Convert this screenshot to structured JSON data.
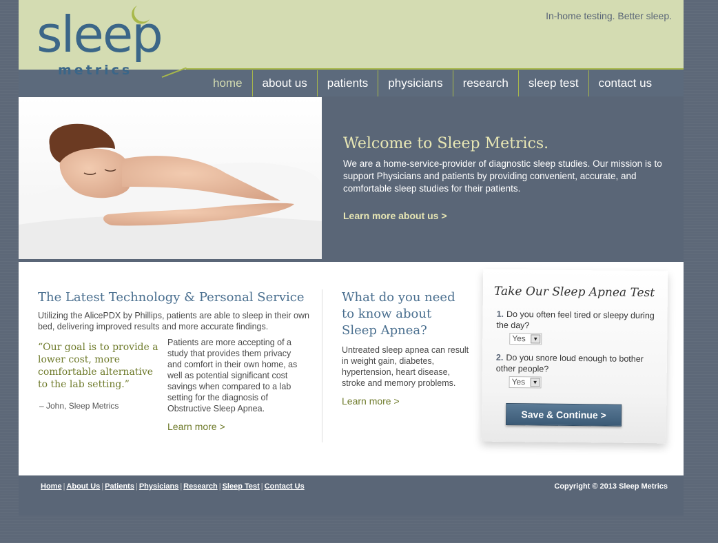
{
  "header": {
    "logo_word": "sleep",
    "logo_sub": "metrics",
    "tagline": "In-home testing. Better sleep."
  },
  "nav": {
    "items": [
      {
        "label": "home"
      },
      {
        "label": "about us"
      },
      {
        "label": "patients"
      },
      {
        "label": "physicians"
      },
      {
        "label": "research"
      },
      {
        "label": "sleep test"
      },
      {
        "label": "contact us"
      }
    ]
  },
  "hero": {
    "title": "Welcome to Sleep Metrics.",
    "body": "We are a home-service-provider of diagnostic sleep studies. Our mission is to support Physicians and patients by providing convenient, accurate, and comfortable sleep studies for their patients.",
    "link": "Learn more about us >"
  },
  "tech": {
    "title": "The Latest Technology & Personal Service",
    "intro": "Utilizing the AlicePDX by Phillips, patients are able to sleep in their own bed, delivering improved results and more accurate findings.",
    "quote": "“Our goal is to provide a lower cost, more comfortable alternative to the lab setting.”",
    "quote_attr": "– John, Sleep Metrics",
    "body": "Patients are more accepting of a study that provides them privacy and comfort in their own home, as well as potential significant cost savings when compared to a lab setting for the diagnosis of Obstructive Sleep Apnea.",
    "link": "Learn more >"
  },
  "apnea": {
    "title": "What do you need to know about Sleep Apnea?",
    "body": "Untreated sleep apnea can result in weight gain, diabetes, hypertension, heart disease, stroke and memory problems.",
    "link": "Learn more >"
  },
  "test": {
    "title": "Take Our Sleep Apnea Test",
    "questions": [
      {
        "num": "1.",
        "text": "Do you often feel tired or sleepy during the day?",
        "value": "Yes"
      },
      {
        "num": "2.",
        "text": "Do you snore loud enough to bother other people?",
        "value": "Yes"
      }
    ],
    "button": "Save & Continue >"
  },
  "footer": {
    "links": [
      "Home",
      "About Us",
      "Patients",
      "Physicians",
      "Research",
      "Sleep Test",
      "Contact Us"
    ],
    "copyright": "Copyright © 2013 Sleep Metrics"
  }
}
